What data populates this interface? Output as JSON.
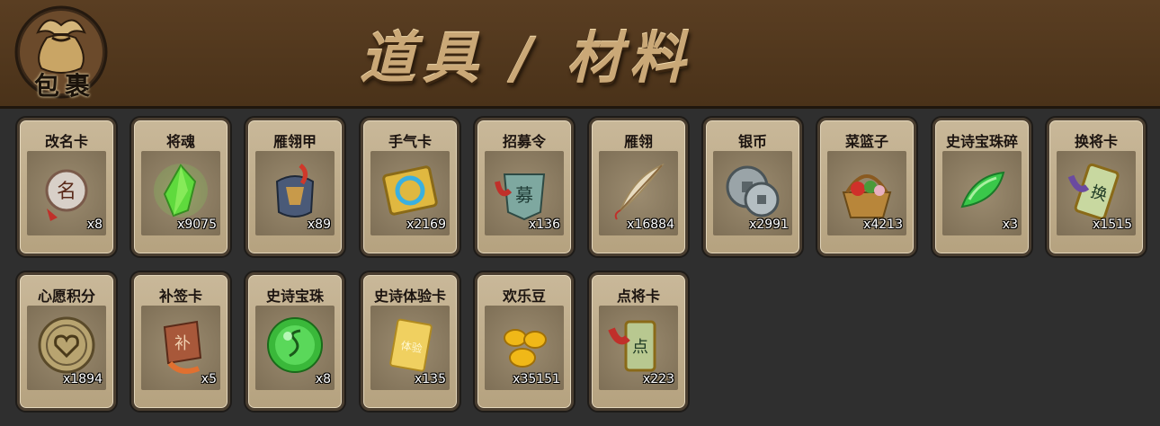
{
  "header": {
    "badge_label": "包裹",
    "title": "道具 / 材料"
  },
  "items": [
    {
      "name": "改名卡",
      "count": "x8",
      "icon": "rename-card-icon"
    },
    {
      "name": "将魂",
      "count": "x9075",
      "icon": "general-soul-icon"
    },
    {
      "name": "雁翎甲",
      "count": "x89",
      "icon": "feather-armor-icon"
    },
    {
      "name": "手气卡",
      "count": "x2169",
      "icon": "luck-card-icon"
    },
    {
      "name": "招募令",
      "count": "x136",
      "icon": "recruit-token-icon"
    },
    {
      "name": "雁翎",
      "count": "x16884",
      "icon": "feather-quill-icon"
    },
    {
      "name": "银币",
      "count": "x2991",
      "icon": "silver-coin-icon"
    },
    {
      "name": "菜篮子",
      "count": "x4213",
      "icon": "basket-icon"
    },
    {
      "name": "史诗宝珠碎",
      "count": "x3",
      "icon": "epic-orb-shard-icon"
    },
    {
      "name": "换将卡",
      "count": "x1515",
      "icon": "swap-general-card-icon"
    },
    {
      "name": "心愿积分",
      "count": "x1894",
      "icon": "wish-coin-icon"
    },
    {
      "name": "补签卡",
      "count": "x5",
      "icon": "makeup-sign-card-icon"
    },
    {
      "name": "史诗宝珠",
      "count": "x8",
      "icon": "epic-orb-icon"
    },
    {
      "name": "史诗体验卡",
      "count": "x135",
      "icon": "epic-trial-card-icon"
    },
    {
      "name": "欢乐豆",
      "count": "x35151",
      "icon": "joy-beans-icon"
    },
    {
      "name": "点将卡",
      "count": "x223",
      "icon": "select-general-card-icon"
    }
  ],
  "colors": {
    "header_bg": "#4e3520",
    "card_bg": "#c2b08f",
    "title_gold": "#caa877",
    "background": "#2f2f2f"
  }
}
